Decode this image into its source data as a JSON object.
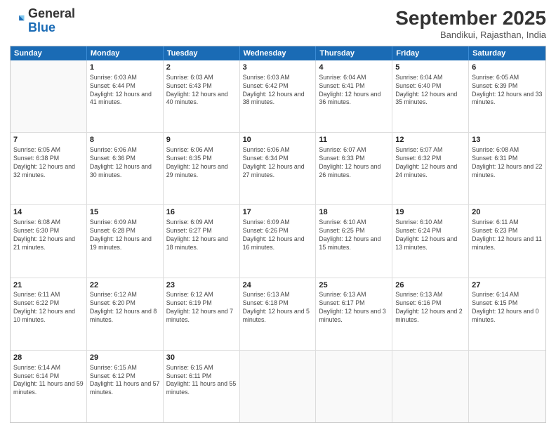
{
  "header": {
    "logo_general": "General",
    "logo_blue": "Blue",
    "month_year": "September 2025",
    "location": "Bandikui, Rajasthan, India"
  },
  "days_of_week": [
    "Sunday",
    "Monday",
    "Tuesday",
    "Wednesday",
    "Thursday",
    "Friday",
    "Saturday"
  ],
  "weeks": [
    [
      {
        "day": "",
        "empty": true
      },
      {
        "day": "1",
        "sunrise": "Sunrise: 6:03 AM",
        "sunset": "Sunset: 6:44 PM",
        "daylight": "Daylight: 12 hours and 41 minutes."
      },
      {
        "day": "2",
        "sunrise": "Sunrise: 6:03 AM",
        "sunset": "Sunset: 6:43 PM",
        "daylight": "Daylight: 12 hours and 40 minutes."
      },
      {
        "day": "3",
        "sunrise": "Sunrise: 6:03 AM",
        "sunset": "Sunset: 6:42 PM",
        "daylight": "Daylight: 12 hours and 38 minutes."
      },
      {
        "day": "4",
        "sunrise": "Sunrise: 6:04 AM",
        "sunset": "Sunset: 6:41 PM",
        "daylight": "Daylight: 12 hours and 36 minutes."
      },
      {
        "day": "5",
        "sunrise": "Sunrise: 6:04 AM",
        "sunset": "Sunset: 6:40 PM",
        "daylight": "Daylight: 12 hours and 35 minutes."
      },
      {
        "day": "6",
        "sunrise": "Sunrise: 6:05 AM",
        "sunset": "Sunset: 6:39 PM",
        "daylight": "Daylight: 12 hours and 33 minutes."
      }
    ],
    [
      {
        "day": "7",
        "sunrise": "Sunrise: 6:05 AM",
        "sunset": "Sunset: 6:38 PM",
        "daylight": "Daylight: 12 hours and 32 minutes."
      },
      {
        "day": "8",
        "sunrise": "Sunrise: 6:06 AM",
        "sunset": "Sunset: 6:36 PM",
        "daylight": "Daylight: 12 hours and 30 minutes."
      },
      {
        "day": "9",
        "sunrise": "Sunrise: 6:06 AM",
        "sunset": "Sunset: 6:35 PM",
        "daylight": "Daylight: 12 hours and 29 minutes."
      },
      {
        "day": "10",
        "sunrise": "Sunrise: 6:06 AM",
        "sunset": "Sunset: 6:34 PM",
        "daylight": "Daylight: 12 hours and 27 minutes."
      },
      {
        "day": "11",
        "sunrise": "Sunrise: 6:07 AM",
        "sunset": "Sunset: 6:33 PM",
        "daylight": "Daylight: 12 hours and 26 minutes."
      },
      {
        "day": "12",
        "sunrise": "Sunrise: 6:07 AM",
        "sunset": "Sunset: 6:32 PM",
        "daylight": "Daylight: 12 hours and 24 minutes."
      },
      {
        "day": "13",
        "sunrise": "Sunrise: 6:08 AM",
        "sunset": "Sunset: 6:31 PM",
        "daylight": "Daylight: 12 hours and 22 minutes."
      }
    ],
    [
      {
        "day": "14",
        "sunrise": "Sunrise: 6:08 AM",
        "sunset": "Sunset: 6:30 PM",
        "daylight": "Daylight: 12 hours and 21 minutes."
      },
      {
        "day": "15",
        "sunrise": "Sunrise: 6:09 AM",
        "sunset": "Sunset: 6:28 PM",
        "daylight": "Daylight: 12 hours and 19 minutes."
      },
      {
        "day": "16",
        "sunrise": "Sunrise: 6:09 AM",
        "sunset": "Sunset: 6:27 PM",
        "daylight": "Daylight: 12 hours and 18 minutes."
      },
      {
        "day": "17",
        "sunrise": "Sunrise: 6:09 AM",
        "sunset": "Sunset: 6:26 PM",
        "daylight": "Daylight: 12 hours and 16 minutes."
      },
      {
        "day": "18",
        "sunrise": "Sunrise: 6:10 AM",
        "sunset": "Sunset: 6:25 PM",
        "daylight": "Daylight: 12 hours and 15 minutes."
      },
      {
        "day": "19",
        "sunrise": "Sunrise: 6:10 AM",
        "sunset": "Sunset: 6:24 PM",
        "daylight": "Daylight: 12 hours and 13 minutes."
      },
      {
        "day": "20",
        "sunrise": "Sunrise: 6:11 AM",
        "sunset": "Sunset: 6:23 PM",
        "daylight": "Daylight: 12 hours and 11 minutes."
      }
    ],
    [
      {
        "day": "21",
        "sunrise": "Sunrise: 6:11 AM",
        "sunset": "Sunset: 6:22 PM",
        "daylight": "Daylight: 12 hours and 10 minutes."
      },
      {
        "day": "22",
        "sunrise": "Sunrise: 6:12 AM",
        "sunset": "Sunset: 6:20 PM",
        "daylight": "Daylight: 12 hours and 8 minutes."
      },
      {
        "day": "23",
        "sunrise": "Sunrise: 6:12 AM",
        "sunset": "Sunset: 6:19 PM",
        "daylight": "Daylight: 12 hours and 7 minutes."
      },
      {
        "day": "24",
        "sunrise": "Sunrise: 6:13 AM",
        "sunset": "Sunset: 6:18 PM",
        "daylight": "Daylight: 12 hours and 5 minutes."
      },
      {
        "day": "25",
        "sunrise": "Sunrise: 6:13 AM",
        "sunset": "Sunset: 6:17 PM",
        "daylight": "Daylight: 12 hours and 3 minutes."
      },
      {
        "day": "26",
        "sunrise": "Sunrise: 6:13 AM",
        "sunset": "Sunset: 6:16 PM",
        "daylight": "Daylight: 12 hours and 2 minutes."
      },
      {
        "day": "27",
        "sunrise": "Sunrise: 6:14 AM",
        "sunset": "Sunset: 6:15 PM",
        "daylight": "Daylight: 12 hours and 0 minutes."
      }
    ],
    [
      {
        "day": "28",
        "sunrise": "Sunrise: 6:14 AM",
        "sunset": "Sunset: 6:14 PM",
        "daylight": "Daylight: 11 hours and 59 minutes."
      },
      {
        "day": "29",
        "sunrise": "Sunrise: 6:15 AM",
        "sunset": "Sunset: 6:12 PM",
        "daylight": "Daylight: 11 hours and 57 minutes."
      },
      {
        "day": "30",
        "sunrise": "Sunrise: 6:15 AM",
        "sunset": "Sunset: 6:11 PM",
        "daylight": "Daylight: 11 hours and 55 minutes."
      },
      {
        "day": "",
        "empty": true
      },
      {
        "day": "",
        "empty": true
      },
      {
        "day": "",
        "empty": true
      },
      {
        "day": "",
        "empty": true
      }
    ]
  ]
}
